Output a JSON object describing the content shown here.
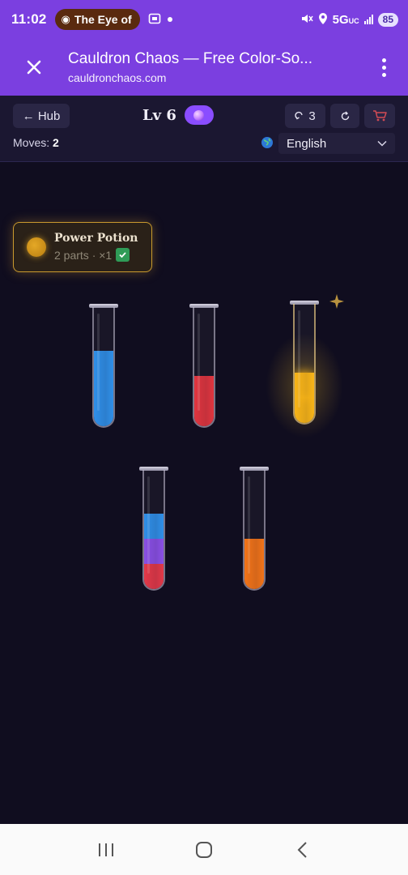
{
  "status_bar": {
    "time": "11:02",
    "notification": "The Eye of",
    "network": "5G",
    "network_sub": "UC",
    "battery": "85"
  },
  "browser": {
    "title": "Cauldron Chaos — Free Color-So...",
    "url": "cauldronchaos.com"
  },
  "header": {
    "hub_label": "← Hub",
    "level_label": "Lv 6",
    "undo_count": "3",
    "moves_label": "Moves:",
    "moves_value": "2",
    "language": "English"
  },
  "potion": {
    "name": "Power Potion",
    "detail": "2 parts · ×1",
    "completed": true,
    "color": "#d99a1a"
  },
  "tubes": [
    {
      "layers": [
        {
          "color": "#2f8fe8"
        },
        {
          "color": "#2f8fe8"
        },
        {
          "color": "#2f8fe8"
        }
      ]
    },
    {
      "layers": [
        {
          "color": "#e0353f"
        },
        {
          "color": "#e0353f"
        }
      ]
    },
    {
      "layers": [
        {
          "color": "#f8b417"
        },
        {
          "color": "#f8b417"
        }
      ],
      "selected": true
    },
    {
      "layers": [
        {
          "color": "#e33848"
        },
        {
          "color": "#8a4fe6"
        },
        {
          "color": "#2f8fe8"
        }
      ]
    },
    {
      "layers": [
        {
          "color": "#f27318"
        },
        {
          "color": "#f27318"
        }
      ]
    }
  ],
  "colors": {
    "accent": "#7b3fe0",
    "header_bg": "#1b1731",
    "play_bg": "#100d1f"
  }
}
